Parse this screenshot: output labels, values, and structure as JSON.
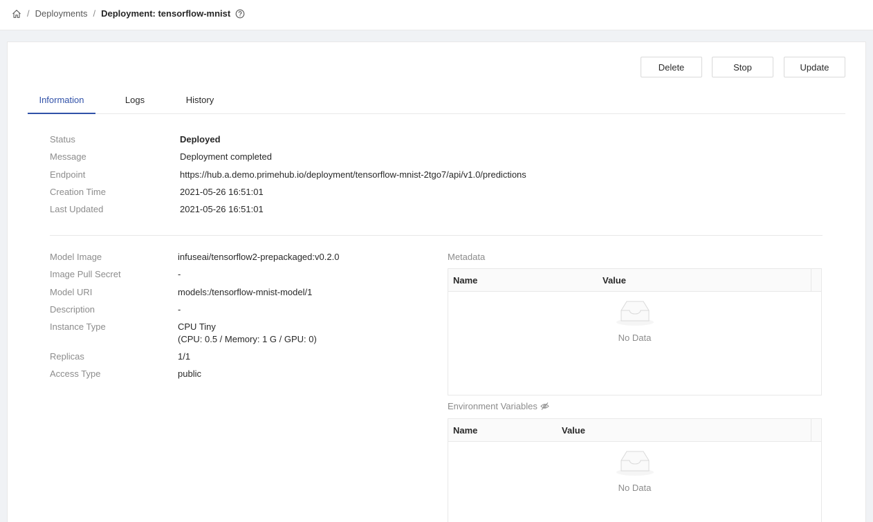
{
  "breadcrumb": {
    "home_icon": "home-icon",
    "items": [
      "Deployments",
      "Deployment: tensorflow-mnist"
    ],
    "separator": "/",
    "help_icon": "question-circle-icon"
  },
  "actions": {
    "delete": "Delete",
    "stop": "Stop",
    "update": "Update"
  },
  "tabs": [
    {
      "label": "Information",
      "active": true
    },
    {
      "label": "Logs",
      "active": false
    },
    {
      "label": "History",
      "active": false
    }
  ],
  "info": {
    "status": {
      "label": "Status",
      "value": "Deployed"
    },
    "message": {
      "label": "Message",
      "value": "Deployment completed"
    },
    "endpoint": {
      "label": "Endpoint",
      "value": "https://hub.a.demo.primehub.io/deployment/tensorflow-mnist-2tgo7/api/v1.0/predictions"
    },
    "creation_time": {
      "label": "Creation Time",
      "value": "2021-05-26 16:51:01"
    },
    "last_updated": {
      "label": "Last Updated",
      "value": "2021-05-26 16:51:01"
    }
  },
  "details": {
    "model_image": {
      "label": "Model Image",
      "value": "infuseai/tensorflow2-prepackaged:v0.2.0"
    },
    "image_pull_secret": {
      "label": "Image Pull Secret",
      "value": "-"
    },
    "model_uri": {
      "label": "Model URI",
      "value": "models:/tensorflow-mnist-model/1"
    },
    "description": {
      "label": "Description",
      "value": "-"
    },
    "instance_type": {
      "label": "Instance Type",
      "value": "CPU Tiny",
      "value2": "(CPU: 0.5 / Memory: 1 G / GPU: 0)"
    },
    "replicas": {
      "label": "Replicas",
      "value": "1/1"
    },
    "access_type": {
      "label": "Access Type",
      "value": "public"
    }
  },
  "metadata": {
    "title": "Metadata",
    "columns": [
      "Name",
      "Value"
    ],
    "empty_text": "No Data"
  },
  "env_vars": {
    "title": "Environment Variables",
    "visibility_icon": "eye-invisible-icon",
    "columns": [
      "Name",
      "Value"
    ],
    "empty_text": "No Data"
  },
  "colors": {
    "accent": "#3051a8",
    "label": "#8c8c8c",
    "border": "#e8e8e8",
    "background": "#f0f2f5"
  }
}
